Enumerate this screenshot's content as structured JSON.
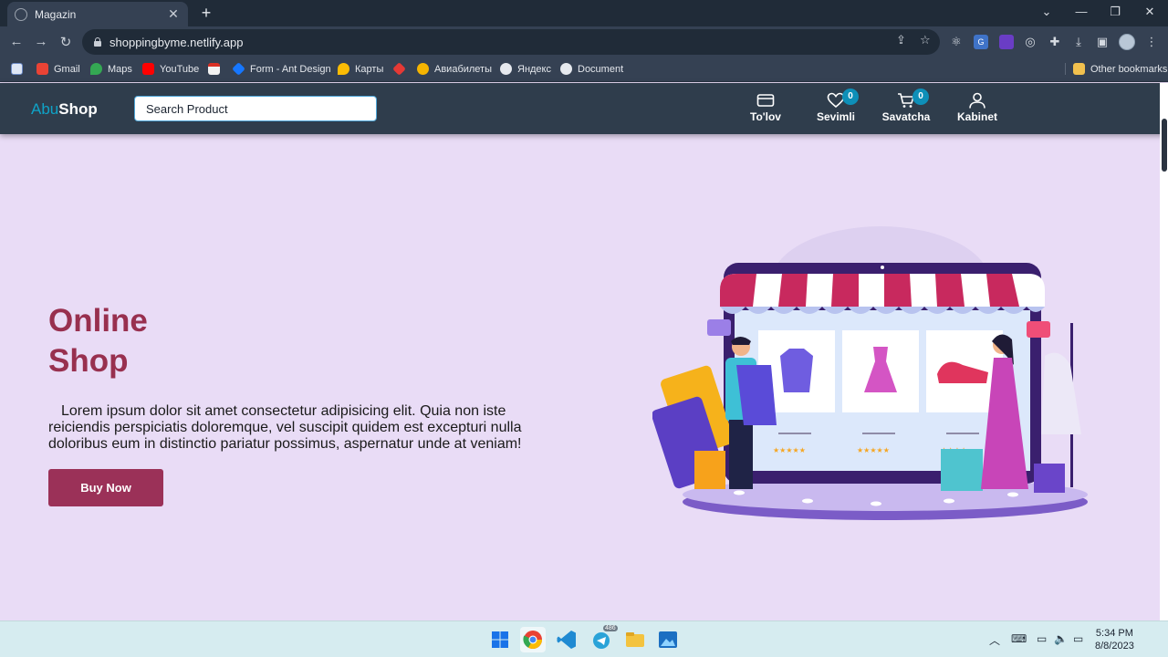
{
  "browser": {
    "tab_title": "Magazin",
    "url": "shoppingbyme.netlify.app",
    "bookmarks": [
      "Gmail",
      "Maps",
      "YouTube",
      "Form - Ant Design",
      "Карты",
      "Авиабилеты",
      "Яндекс",
      "Document"
    ],
    "other_bookmarks": "Other bookmarks"
  },
  "header": {
    "logo_part1": "Abu",
    "logo_part2": "Shop",
    "search_placeholder": "Search Product",
    "nav": {
      "payment": "To'lov",
      "favorites": "Sevimli",
      "favorites_count": "0",
      "cart": "Savatcha",
      "cart_count": "0",
      "account": "Kabinet"
    }
  },
  "hero": {
    "title_line1": "Online",
    "title_line2": "Shop",
    "text": "Lorem ipsum dolor sit amet consectetur adipisicing elit. Quia non iste reiciendis perspiciatis doloremque, vel suscipit quidem est excepturi nulla doloribus eum in distinctio pariatur possimus, aspernatur unde at veniam!",
    "button": "Buy Now"
  },
  "taskbar": {
    "time": "5:34 PM",
    "date": "8/8/2023",
    "telegram_badge": "486"
  },
  "colors": {
    "accent": "#0fa3c7",
    "brand": "#98304f",
    "button": "#9b3158",
    "header_bg": "#2f3d4c",
    "page_bg": "#e9dcf6"
  }
}
